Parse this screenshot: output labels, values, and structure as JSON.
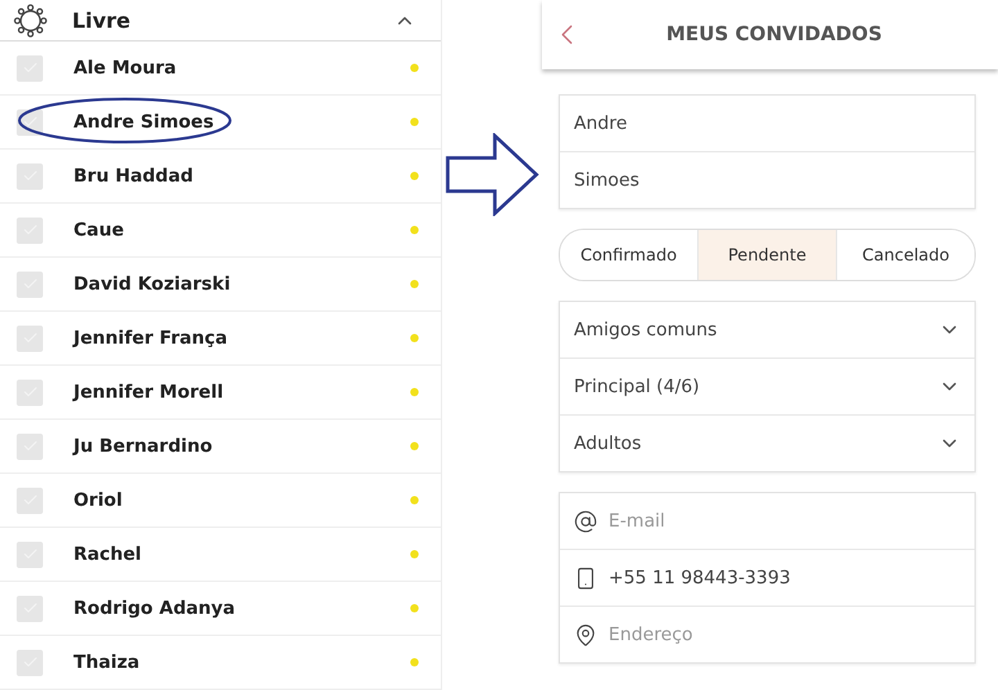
{
  "group": {
    "title": "Livre",
    "expanded": true
  },
  "guests": [
    {
      "name": "Ale Moura",
      "checked": false,
      "highlighted": false
    },
    {
      "name": "Andre Simoes",
      "checked": false,
      "highlighted": true
    },
    {
      "name": "Bru Haddad",
      "checked": false,
      "highlighted": false
    },
    {
      "name": "Caue",
      "checked": false,
      "highlighted": false
    },
    {
      "name": "David Koziarski",
      "checked": false,
      "highlighted": false
    },
    {
      "name": "Jennifer França",
      "checked": false,
      "highlighted": false
    },
    {
      "name": "Jennifer Morell",
      "checked": false,
      "highlighted": false
    },
    {
      "name": "Ju Bernardino",
      "checked": false,
      "highlighted": false
    },
    {
      "name": "Oriol",
      "checked": false,
      "highlighted": false
    },
    {
      "name": "Rachel",
      "checked": false,
      "highlighted": false
    },
    {
      "name": "Rodrigo Adanya",
      "checked": false,
      "highlighted": false
    },
    {
      "name": "Thaiza",
      "checked": false,
      "highlighted": false
    }
  ],
  "screen": {
    "title": "MEUS CONVIDADOS"
  },
  "name_fields": [
    {
      "value": "Andre"
    },
    {
      "value": "Simoes"
    }
  ],
  "status_tabs": [
    {
      "label": "Confirmado",
      "selected": false
    },
    {
      "label": "Pendente",
      "selected": true
    },
    {
      "label": "Cancelado",
      "selected": false
    }
  ],
  "dropdowns": [
    {
      "label": "Amigos comuns"
    },
    {
      "label": "Principal (4/6)"
    },
    {
      "label": "Adultos"
    }
  ],
  "contact_fields": [
    {
      "kind": "email",
      "placeholder": "E-mail"
    },
    {
      "kind": "phone",
      "value": "+55 11 98443-3393"
    },
    {
      "kind": "address",
      "placeholder": "Endereço"
    }
  ]
}
